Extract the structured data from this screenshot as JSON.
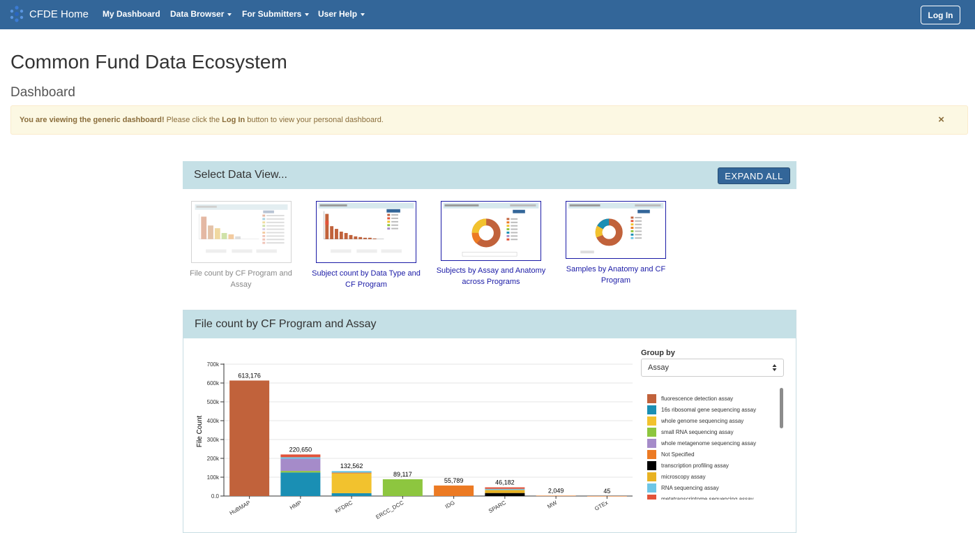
{
  "navbar": {
    "brand": "CFDE Home",
    "items": [
      {
        "label": "My Dashboard",
        "dropdown": false
      },
      {
        "label": "Data Browser",
        "dropdown": true
      },
      {
        "label": "For Submitters",
        "dropdown": true
      },
      {
        "label": "User Help",
        "dropdown": true
      }
    ],
    "login_label": "Log In",
    "background_color": "#336699"
  },
  "page": {
    "title": "Common Fund Data Ecosystem",
    "subtitle": "Dashboard"
  },
  "alert": {
    "strong": "You are viewing the generic dashboard!",
    "text_before": " Please click the ",
    "emphasis": "Log In",
    "text_after": " button to view your personal dashboard.",
    "close": "×"
  },
  "select_view": {
    "title": "Select Data View...",
    "expand_label": "EXPAND ALL",
    "thumbnails": [
      {
        "label": "File count by CF Program and Assay",
        "active": false
      },
      {
        "label": "Subject count by Data Type and CF Program",
        "active": true
      },
      {
        "label": "Subjects by Assay and Anatomy across Programs",
        "active": true
      },
      {
        "label": "Samples by Anatomy and CF Program",
        "active": true
      }
    ]
  },
  "chart_panel": {
    "title": "File count by CF Program and Assay",
    "group_by_label": "Group by",
    "group_by_value": "Assay",
    "legend": [
      {
        "label": "fluorescence detection assay",
        "color": "#c1623b"
      },
      {
        "label": "16s ribosomal gene sequencing assay",
        "color": "#1a8fb4"
      },
      {
        "label": "whole genome sequencing assay",
        "color": "#f2c22e"
      },
      {
        "label": "small RNA sequencing assay",
        "color": "#8dc63f"
      },
      {
        "label": "whole metagenome sequencing assay",
        "color": "#a58bc9"
      },
      {
        "label": "Not Specified",
        "color": "#ec7a23"
      },
      {
        "label": "transcription profiling assay",
        "color": "#000000"
      },
      {
        "label": "microscopy assay",
        "color": "#e8b222"
      },
      {
        "label": "RNA sequencing assay",
        "color": "#6ec6e6"
      },
      {
        "label": "metatranscriptome sequencing assay",
        "color": "#e2533a"
      }
    ]
  },
  "chart_data": {
    "type": "bar",
    "stacked": true,
    "ylabel": "File Count",
    "xlabel": "",
    "ylim": [
      0,
      700000
    ],
    "yticks": [
      "0.0",
      "100k",
      "200k",
      "300k",
      "400k",
      "500k",
      "600k",
      "700k"
    ],
    "grid": true,
    "categories": [
      "HuBMAP",
      "HMP",
      "KFDRC",
      "ERCC_DCC",
      "IDG",
      "SPARC",
      "MW",
      "GTEx"
    ],
    "totals": [
      613176,
      220650,
      132562,
      89117,
      55789,
      46182,
      2049,
      45
    ],
    "total_labels": [
      "613,176",
      "220,650",
      "132,562",
      "89,117",
      "55,789",
      "46,182",
      "2,049",
      "45"
    ],
    "series": [
      {
        "name": "fluorescence detection assay",
        "values": [
          613176,
          0,
          0,
          0,
          0,
          0,
          0,
          0
        ]
      },
      {
        "name": "16s ribosomal gene sequencing assay",
        "values": [
          0,
          125000,
          15000,
          0,
          0,
          0,
          0,
          0
        ]
      },
      {
        "name": "whole genome sequencing assay",
        "values": [
          0,
          0,
          105000,
          0,
          0,
          0,
          0,
          0
        ]
      },
      {
        "name": "small RNA sequencing assay",
        "values": [
          0,
          8000,
          0,
          89117,
          0,
          0,
          0,
          0
        ]
      },
      {
        "name": "whole metagenome sequencing assay",
        "values": [
          0,
          65000,
          0,
          0,
          0,
          0,
          0,
          0
        ]
      },
      {
        "name": "Not Specified",
        "values": [
          0,
          0,
          4000,
          0,
          55789,
          0,
          2049,
          45
        ]
      },
      {
        "name": "transcription profiling assay",
        "values": [
          0,
          0,
          0,
          0,
          0,
          16000,
          0,
          0
        ]
      },
      {
        "name": "microscopy assay",
        "values": [
          0,
          0,
          0,
          0,
          0,
          16000,
          0,
          0
        ]
      },
      {
        "name": "RNA sequencing assay",
        "values": [
          0,
          8000,
          8562,
          0,
          0,
          6000,
          0,
          0
        ]
      },
      {
        "name": "metatranscriptome sequencing assay",
        "values": [
          0,
          14650,
          0,
          0,
          0,
          8182,
          0,
          0
        ]
      }
    ]
  }
}
